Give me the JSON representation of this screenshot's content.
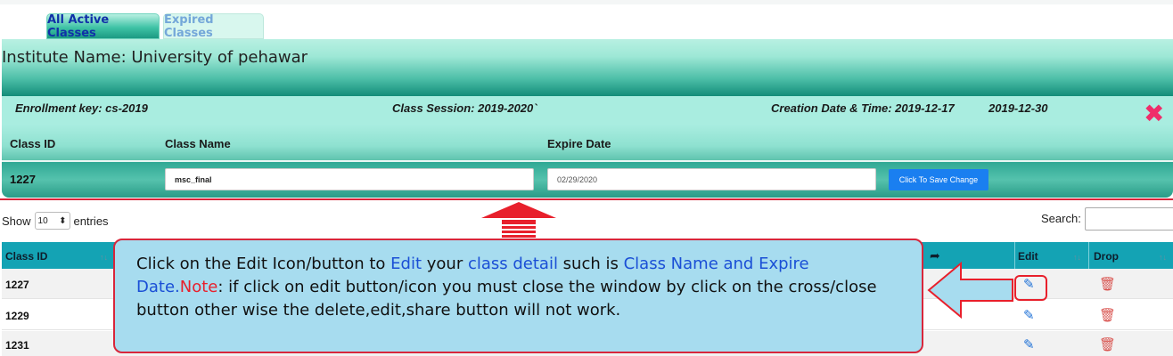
{
  "tabs": {
    "active": "All Active Classes",
    "expired": "Expired Classes"
  },
  "panel": {
    "institute_title": "Institute Name: University of pehawar",
    "enrollment": "Enrollment key: cs-2019",
    "session": "Class Session: 2019-2020`",
    "creation_date": "Creation Date & Time: 2019-12-17",
    "creation_expiry": "2019-12-30",
    "headers": {
      "class_id": "Class ID",
      "class_name": "Class Name",
      "expire_date": "Expire Date"
    },
    "row": {
      "class_id": "1227",
      "class_name": "msc_final",
      "expire_date": "02/29/2020"
    },
    "save_button": "Click To Save Change"
  },
  "table_controls": {
    "show_label": "Show",
    "entries_value": "10",
    "entries_label": "entries",
    "search_label": "Search:"
  },
  "table": {
    "headers": {
      "class_id": "Class ID",
      "edit": "Edit",
      "drop": "Drop"
    },
    "rows": [
      {
        "class_id": "1227"
      },
      {
        "class_id": "1229"
      },
      {
        "class_id": "1231"
      }
    ]
  },
  "callout": {
    "p1": "Click on the Edit Icon/button  to ",
    "p2": "Edit",
    "p3": " your ",
    "p4": "class detail",
    "p5": " such is ",
    "p6": "Class Name and Expire Date.",
    "p7": "Note",
    "p8": ": if click on edit button/icon you must close the window by click on the cross/close button other wise the delete,edit,share button will not work."
  },
  "colors": {
    "accent_red": "#e8202c",
    "teal": "#14a3b4",
    "save_blue": "#1a7ff0"
  },
  "icons": {
    "close": "close-x-icon",
    "edit": "pencil-icon",
    "drop": "trash-icon",
    "share": "share-arrow-icon"
  }
}
